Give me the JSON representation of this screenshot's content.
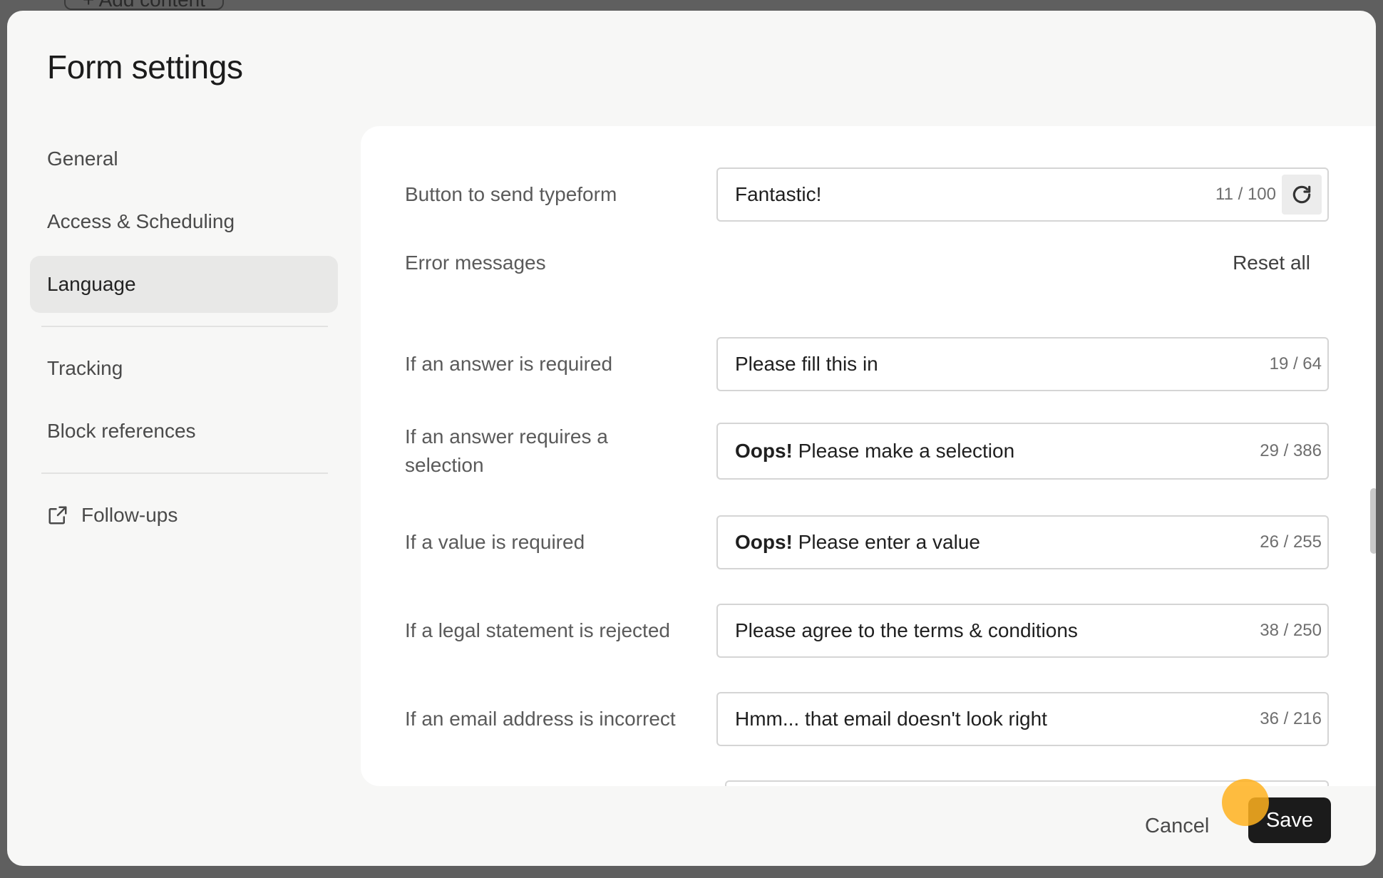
{
  "background": {
    "toolbar": {
      "add_content_label": "+ Add content"
    }
  },
  "modal": {
    "title": "Form settings"
  },
  "sidebar": {
    "items": [
      {
        "label": "General"
      },
      {
        "label": "Access & Scheduling"
      },
      {
        "label": "Language",
        "active": true
      },
      {
        "label": "Tracking"
      },
      {
        "label": "Block references"
      },
      {
        "label": "Follow-ups",
        "icon": "external-link-icon"
      }
    ]
  },
  "content": {
    "submit_button": {
      "label": "Button to send typeform",
      "value": "Fantastic!",
      "counter": "11 / 100",
      "reset_icon": "refresh-icon"
    },
    "error_messages": {
      "label": "Error messages",
      "reset_all": "Reset all",
      "items": [
        {
          "label": "If an answer is required",
          "bold": "",
          "value": "Please fill this in",
          "counter": "19 / 64"
        },
        {
          "label": "If an answer requires a selection",
          "bold": "Oops!",
          "value": " Please make a selection",
          "counter": "29 / 386"
        },
        {
          "label": "If a value is required",
          "bold": "Oops!",
          "value": " Please enter a value",
          "counter": "26 / 255"
        },
        {
          "label": "If a legal statement is rejected",
          "bold": "",
          "value": "Please agree to the terms & conditions",
          "counter": "38 / 250"
        },
        {
          "label": "If an email address is incorrect",
          "bold": "",
          "value": "Hmm... that email doesn't look right",
          "counter": "36 / 216"
        }
      ]
    }
  },
  "footer": {
    "cancel": "Cancel",
    "save": "Save"
  },
  "colors": {
    "modal_bg": "#f7f7f6",
    "panel_bg": "#ffffff",
    "save_bg": "#1b1b1b",
    "active_nav_bg": "#e8e8e7",
    "cursor_highlight": "#ffb21e"
  }
}
